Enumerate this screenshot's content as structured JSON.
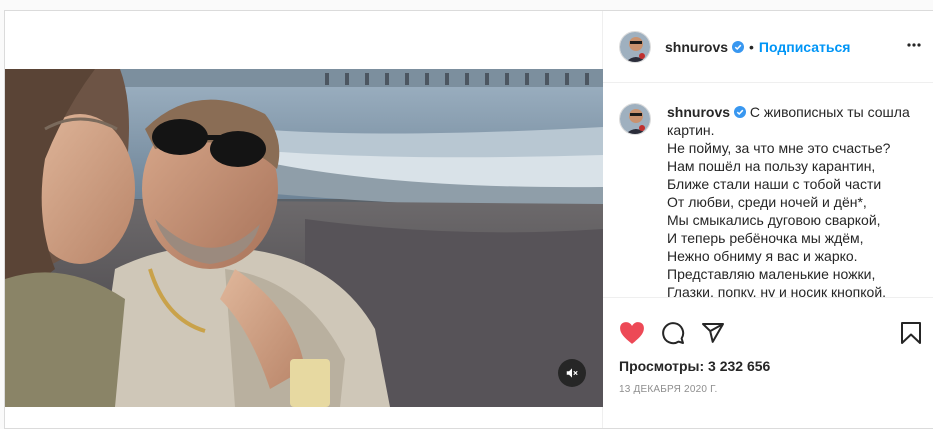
{
  "post": {
    "username": "shnurovs",
    "follow_label": "Подписаться",
    "separator": "•",
    "caption_lines": [
      "С живописных ты сошла",
      "картин.",
      "Не пойму, за что мне это счастье?",
      "Нам пошёл на пользу карантин,",
      "Ближе стали наши с тобой части",
      "От любви, среди ночей и дён*,",
      "Мы смыкались дуговою сваркой,",
      "И теперь ребёночка мы ждём,",
      "Нежно обниму я вас и жарко.",
      "Представляю маленькие ножки,",
      "Глазки, попку, ну и носик кнопкой."
    ],
    "views_label": "Просмотры: 3 232 656",
    "date": "13 ДЕКАБРЯ 2020 Г."
  },
  "icons": {
    "like": "heart-icon",
    "comment": "comment-icon",
    "share": "share-icon",
    "save": "bookmark-icon",
    "mute": "mute-icon",
    "more": "more-options-icon",
    "verified": "verified-badge-icon"
  },
  "colors": {
    "like": "#ed4956",
    "follow": "#0095f6",
    "verified": "#3897f0",
    "muted_text": "#8e8e8e"
  }
}
